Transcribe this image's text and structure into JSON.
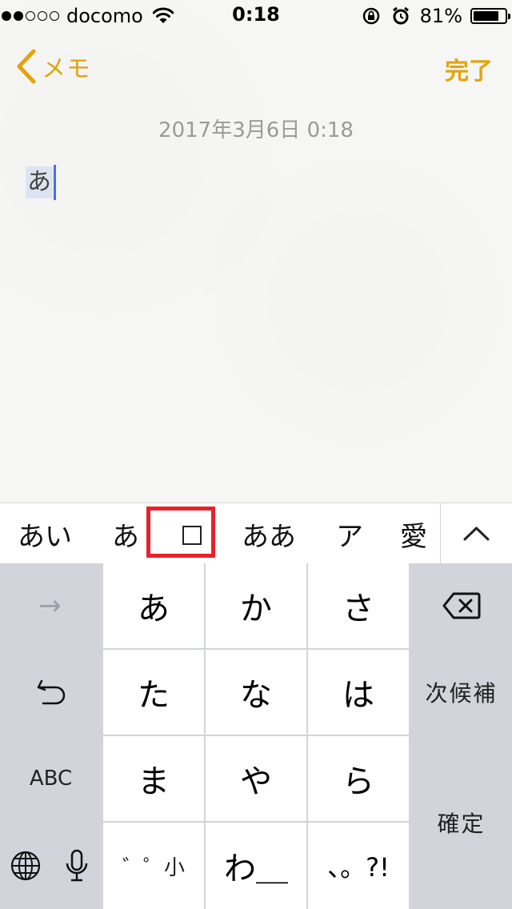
{
  "status_bar": {
    "carrier": "docomo",
    "signal_bars_filled": 2,
    "signal_bars_total": 5,
    "time": "0:18",
    "battery_percent_text": "81%",
    "battery_level": 0.81
  },
  "nav": {
    "back_label": "メモ",
    "done_label": "完了",
    "accent_color": "#e1a411"
  },
  "note": {
    "date": "2017年3月6日 0:18",
    "marked_text": "あ"
  },
  "candidates": {
    "items": [
      "あい",
      "あ",
      "□",
      "ああ",
      "ア",
      "愛"
    ],
    "highlighted_index": 2,
    "highlight_color": "#e8212b"
  },
  "keyboard": {
    "row1": {
      "left": "→",
      "keys": [
        "あ",
        "か",
        "さ"
      ],
      "right": "delete"
    },
    "row2": {
      "left": "undo",
      "keys": [
        "た",
        "な",
        "は"
      ],
      "right": "次候補"
    },
    "row3": {
      "left": "ABC",
      "keys": [
        "ま",
        "や",
        "ら"
      ]
    },
    "row4": {
      "left_a": "globe",
      "left_b": "microphone",
      "keys": [
        "゛゜小",
        "わ＿",
        "、。?!"
      ]
    },
    "confirm": "確定"
  }
}
